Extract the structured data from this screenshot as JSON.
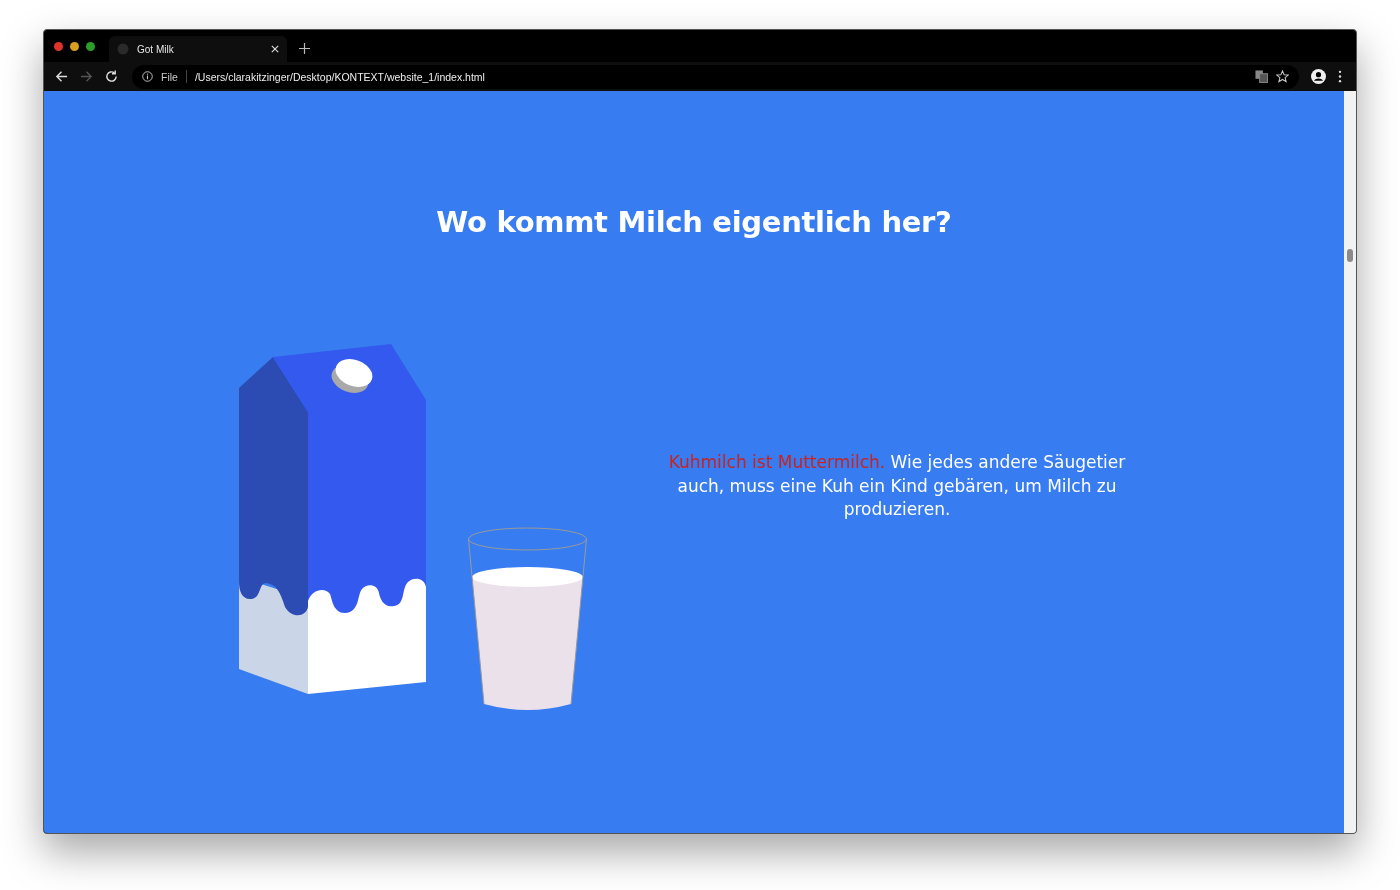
{
  "browser": {
    "tab_title": "Got Milk",
    "scheme_label": "File",
    "url": "/Users/clarakitzinger/Desktop/KONTEXT/website_1/index.html",
    "forward_disabled": true
  },
  "page": {
    "title": "Wo kommt Milch eigentlich her?",
    "paragraph": {
      "highlight": "Kuhmilch ist Muttermilch.",
      "text": "Wie jedes andere Säugetier auch, muss eine Kuh ein Kind gebären, um Milch zu produzieren."
    }
  }
}
